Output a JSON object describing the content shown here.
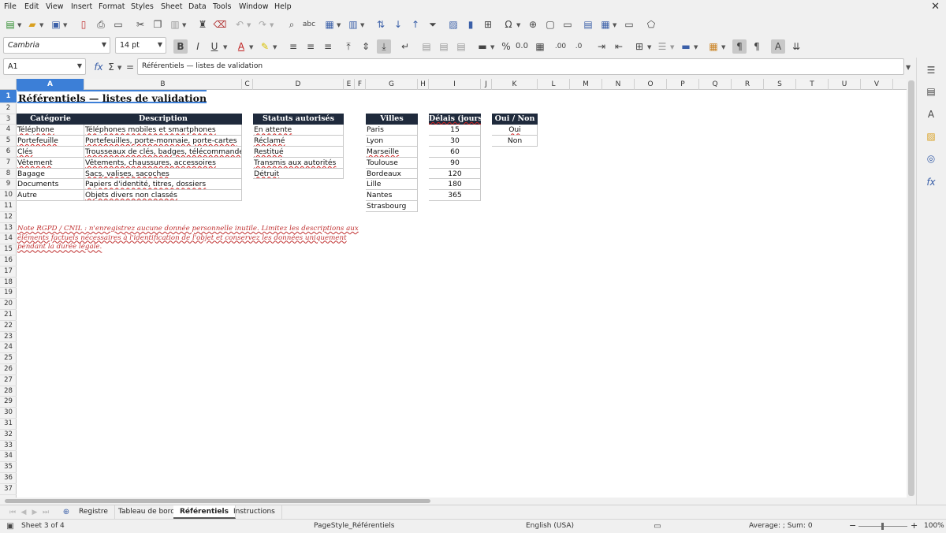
{
  "menu": [
    "File",
    "Edit",
    "View",
    "Insert",
    "Format",
    "Styles",
    "Sheet",
    "Data",
    "Tools",
    "Window",
    "Help"
  ],
  "toolbar": {
    "font_name": "Cambria",
    "font_size": "14 pt"
  },
  "formula_bar": {
    "name_box": "A1",
    "content": "Référentiels — listes de validation"
  },
  "columns": [
    "A",
    "B",
    "C",
    "D",
    "E",
    "F",
    "G",
    "H",
    "I",
    "J",
    "K",
    "L",
    "M",
    "N",
    "O",
    "P",
    "Q",
    "R",
    "S",
    "T",
    "U",
    "V"
  ],
  "row_count": 37,
  "sheet": {
    "title": "Référentiels — listes de validation",
    "categories_header": [
      "Catégorie",
      "Description"
    ],
    "categories": [
      [
        "Téléphone",
        "Téléphones mobiles et smartphones"
      ],
      [
        "Portefeuille",
        "Portefeuilles, porte-monnaie, porte-cartes"
      ],
      [
        "Clés",
        "Trousseaux de clés, badges, télécommandes"
      ],
      [
        "Vêtement",
        "Vêtements, chaussures, accessoires"
      ],
      [
        "Bagage",
        "Sacs, valises, sacoches"
      ],
      [
        "Documents",
        "Papiers d'identité, titres, dossiers"
      ],
      [
        "Autre",
        "Objets divers non classés"
      ]
    ],
    "statuts_header": "Statuts autorisés",
    "statuts": [
      "En attente",
      "Réclamé",
      "Restitué",
      "Transmis aux autorités",
      "Détruit"
    ],
    "villes_header": "Villes",
    "villes": [
      "Paris",
      "Lyon",
      "Marseille",
      "Toulouse",
      "Bordeaux",
      "Lille",
      "Nantes",
      "Strasbourg"
    ],
    "delais_header": "Délais (jours)",
    "delais": [
      "15",
      "30",
      "60",
      "90",
      "120",
      "180",
      "365"
    ],
    "ouinon_header": "Oui / Non",
    "ouinon": [
      "Oui",
      "Non"
    ],
    "note": "Note RGPD / CNIL : n'enregistrez aucune donnée personnelle inutile. Limitez les descriptions aux éléments factuels nécessaires à l'identification de l'objet et conservez les données uniquement pendant la durée légale."
  },
  "tabs": [
    "Registre",
    "Tableau de bord",
    "Référentiels",
    "Instructions"
  ],
  "active_tab": "Référentiels",
  "status": {
    "sheet": "Sheet 3 of 4",
    "page_style": "PageStyle_Référentiels",
    "language": "English (USA)",
    "summary": "Average: ; Sum: 0",
    "zoom": "100%"
  }
}
